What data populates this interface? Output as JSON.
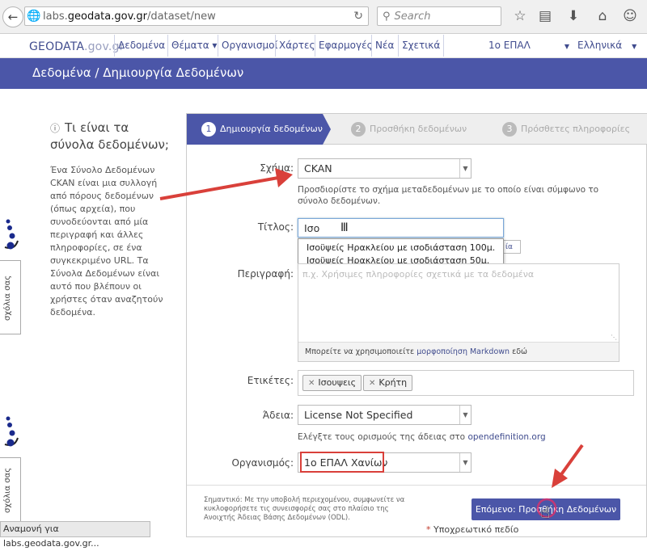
{
  "browser": {
    "url_prefix": "labs.",
    "url_domain": "geodata.gov.gr",
    "url_path": "/dataset/new",
    "search_placeholder": "Search",
    "status_text": "Αναμονή για labs.geodata.gov.gr..."
  },
  "site": {
    "logo_main": "GEODATA",
    "logo_suffix": ".gov.gr",
    "nav": [
      "Δεδομένα",
      "Θέματα ▾",
      "Οργανισμοί",
      "Χάρτες",
      "Εφαρμογές",
      "Νέα",
      "Σχετικά"
    ],
    "org_menu": "1ο ΕΠΑΛ",
    "language_menu": "Ελληνικά"
  },
  "banner": {
    "breadcrumb": "Δεδομένα / Δημιουργία Δεδομένων"
  },
  "info": {
    "title": "Τι είναι τα σύνολα δεδομένων;",
    "text": "Ένα Σύνολο Δεδομένων CKAN είναι μια συλλογή από πόρους δεδομένων (όπως αρχεία), που συνοδεύονται από μία περιγραφή και άλλες πληροφορίες, σε ένα συγκεκριμένο URL. Τα Σύνολα Δεδομένων είναι αυτό που βλέπουν οι χρήστες όταν αναζητούν δεδομένα."
  },
  "side_widget": {
    "label": "σχόλια σας"
  },
  "steps": [
    {
      "num": "1",
      "label": "Δημιουργία δεδομένων"
    },
    {
      "num": "2",
      "label": "Προσθήκη δεδομένων"
    },
    {
      "num": "3",
      "label": "Πρόσθετες πληροφορίες"
    }
  ],
  "form": {
    "schema_label": "Σχήμα:",
    "schema_value": "CKAN",
    "schema_help": "Προσδιορίστε το σχήμα μεταδεδομένων με το οποίο είναι σύμφωνο το σύνολο δεδομένων.",
    "title_label": "Τίτλος:",
    "title_value": "Ισο",
    "autocomplete": [
      "Ισοϋψείς Ηρακλείου με ισοδιάσταση 100μ.",
      "Ισοϋψείς Ηρακλείου με ισοδιάσταση 50μ."
    ],
    "url_edit_fragment": "ία",
    "desc_label": "Περιγραφή:",
    "desc_placeholder": "π.χ. Χρήσιμες πληροφορίες σχετικά με τα δεδομένα",
    "markdown_prefix": "Μπορείτε να χρησιμοποιείτε ",
    "markdown_link": "μορφοποίηση Markdown",
    "markdown_suffix": " εδώ",
    "tags_label": "Ετικέτες:",
    "tags": [
      "Ισουψεις",
      "Κρήτη"
    ],
    "license_label": "Άδεια:",
    "license_value": "License Not Specified",
    "license_help_prefix": "Ελέγξτε τους ορισμούς της άδειας στο ",
    "license_help_link": "opendefinition.org",
    "org_label": "Οργανισμός:",
    "org_value": "1ο ΕΠΑΛ Χανίων",
    "footnote": "Σημαντικό: Με την υποβολή περιεχομένου, συμφωνείτε να κυκλοφορήσετε τις συνεισφορές σας στο πλαίσιο της Ανοιχτής Άδειας Βάσης Δεδομένων (ODL).",
    "next_button": "Επόμενο: Προσθήκη Δεδομένων",
    "required_marker": "*",
    "required_text": " Υποχρεωτικό πεδίο"
  },
  "colors": {
    "brand": "#4b56a8",
    "annotation": "#d9403a"
  },
  "icons": [
    "back-arrow-icon",
    "globe-icon",
    "reload-icon",
    "search-icon",
    "star-icon",
    "reading-list-icon",
    "download-icon",
    "home-icon",
    "smiley-icon",
    "info-icon",
    "close-icon",
    "caret-down-icon",
    "hand-cursor-icon",
    "text-cursor-icon"
  ]
}
